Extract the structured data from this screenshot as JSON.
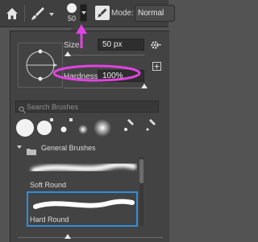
{
  "options_bar": {
    "brush_preset_size": "50",
    "mode_label": "Mode:",
    "mode_value": "Normal"
  },
  "brush_panel": {
    "size_label": "Size:",
    "size_value": "50 px",
    "size_fraction": 0.05,
    "hardness_label": "Hardness:",
    "hardness_value": "100%",
    "hardness_fraction": 1.0,
    "search_placeholder": "Search Brushes",
    "group_name": "General Brushes",
    "brushes": [
      {
        "name": "Soft Round",
        "selected": false
      },
      {
        "name": "Hard Round",
        "selected": true
      }
    ]
  },
  "colors": {
    "highlight_annotation": "#e043e0",
    "selection": "#2f8fdb"
  }
}
